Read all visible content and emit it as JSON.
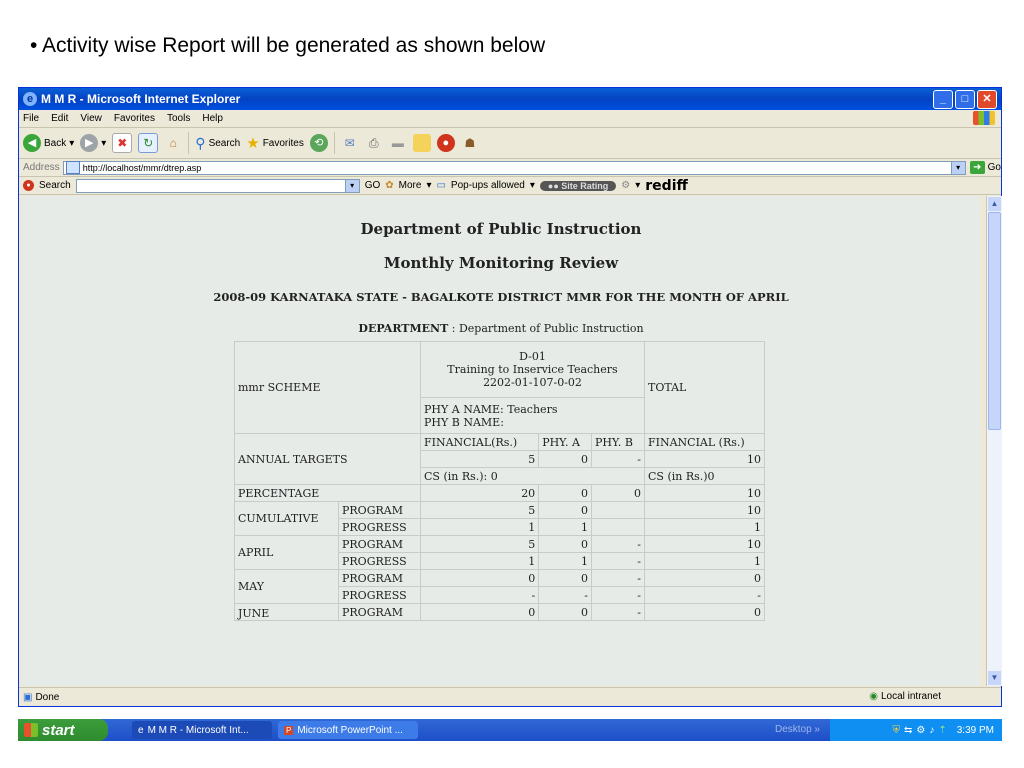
{
  "slide": {
    "caption": "• Activity wise Report will be generated as shown below"
  },
  "window": {
    "title": "M M R - Microsoft Internet Explorer",
    "menu": [
      "File",
      "Edit",
      "View",
      "Favorites",
      "Tools",
      "Help"
    ],
    "toolbar": {
      "back": "Back",
      "search": "Search",
      "favorites": "Favorites"
    },
    "address": {
      "label": "Address",
      "url": "http://localhost/mmr/dtrep.asp",
      "go": "Go"
    },
    "searchbar": {
      "label": "Search",
      "go": "GO",
      "more": "More",
      "popups": "Pop-ups allowed",
      "site_rating": "Site Rating",
      "brand": "rediff"
    },
    "status": {
      "left": "Done",
      "zone": "Local intranet"
    }
  },
  "page": {
    "heading1": "Department of Public Instruction",
    "heading2": "Monthly Monitoring Review",
    "heading3": "2008-09 KARNATAKA STATE - BAGALKOTE DISTRICT MMR FOR THE MONTH OF APRIL",
    "dept_label": "DEPARTMENT",
    "dept_value": " : Department of Public Instruction"
  },
  "report": {
    "scheme_label": "mmr SCHEME",
    "scheme_code": "D-01",
    "scheme_name": "Training to Inservice Teachers",
    "scheme_account": "2202-01-107-0-02",
    "total_label": "TOTAL",
    "phy_a_name": "PHY A NAME: Teachers",
    "phy_b_name": "PHY B NAME:",
    "annual_targets_label": "ANNUAL TARGETS",
    "col_financial": "FINANCIAL(Rs.)",
    "col_phy_a": "PHY. A",
    "col_phy_b": "PHY. B",
    "col_total_financial": "FINANCIAL (Rs.)",
    "targets": {
      "financial": "5",
      "phy_a": "0",
      "phy_b": "-",
      "total": "10"
    },
    "cs_scheme": "CS (in Rs.): 0",
    "cs_total": "CS (in Rs.)0",
    "percentage": {
      "label": "PERCENTAGE",
      "financial": "20",
      "phy_a": "0",
      "phy_b": "0",
      "total": "10"
    },
    "periods": [
      {
        "label": "CUMULATIVE",
        "rows": [
          {
            "kind": "PROGRAM",
            "financial": "5",
            "phy_a": "0",
            "phy_b": "",
            "total": "10"
          },
          {
            "kind": "PROGRESS",
            "financial": "1",
            "phy_a": "1",
            "phy_b": "",
            "total": "1"
          }
        ]
      },
      {
        "label": "APRIL",
        "rows": [
          {
            "kind": "PROGRAM",
            "financial": "5",
            "phy_a": "0",
            "phy_b": "-",
            "total": "10"
          },
          {
            "kind": "PROGRESS",
            "financial": "1",
            "phy_a": "1",
            "phy_b": "-",
            "total": "1"
          }
        ]
      },
      {
        "label": "MAY",
        "rows": [
          {
            "kind": "PROGRAM",
            "financial": "0",
            "phy_a": "0",
            "phy_b": "-",
            "total": "0"
          },
          {
            "kind": "PROGRESS",
            "financial": "-",
            "phy_a": "-",
            "phy_b": "-",
            "total": "-"
          }
        ]
      },
      {
        "label": "JUNE",
        "rows": [
          {
            "kind": "PROGRAM",
            "financial": "0",
            "phy_a": "0",
            "phy_b": "-",
            "total": "0"
          }
        ]
      }
    ]
  },
  "taskbar": {
    "start": "start",
    "task1": "M M R - Microsoft Int...",
    "task2": "Microsoft PowerPoint ...",
    "desktop": "Desktop",
    "clock": "3:39 PM"
  }
}
